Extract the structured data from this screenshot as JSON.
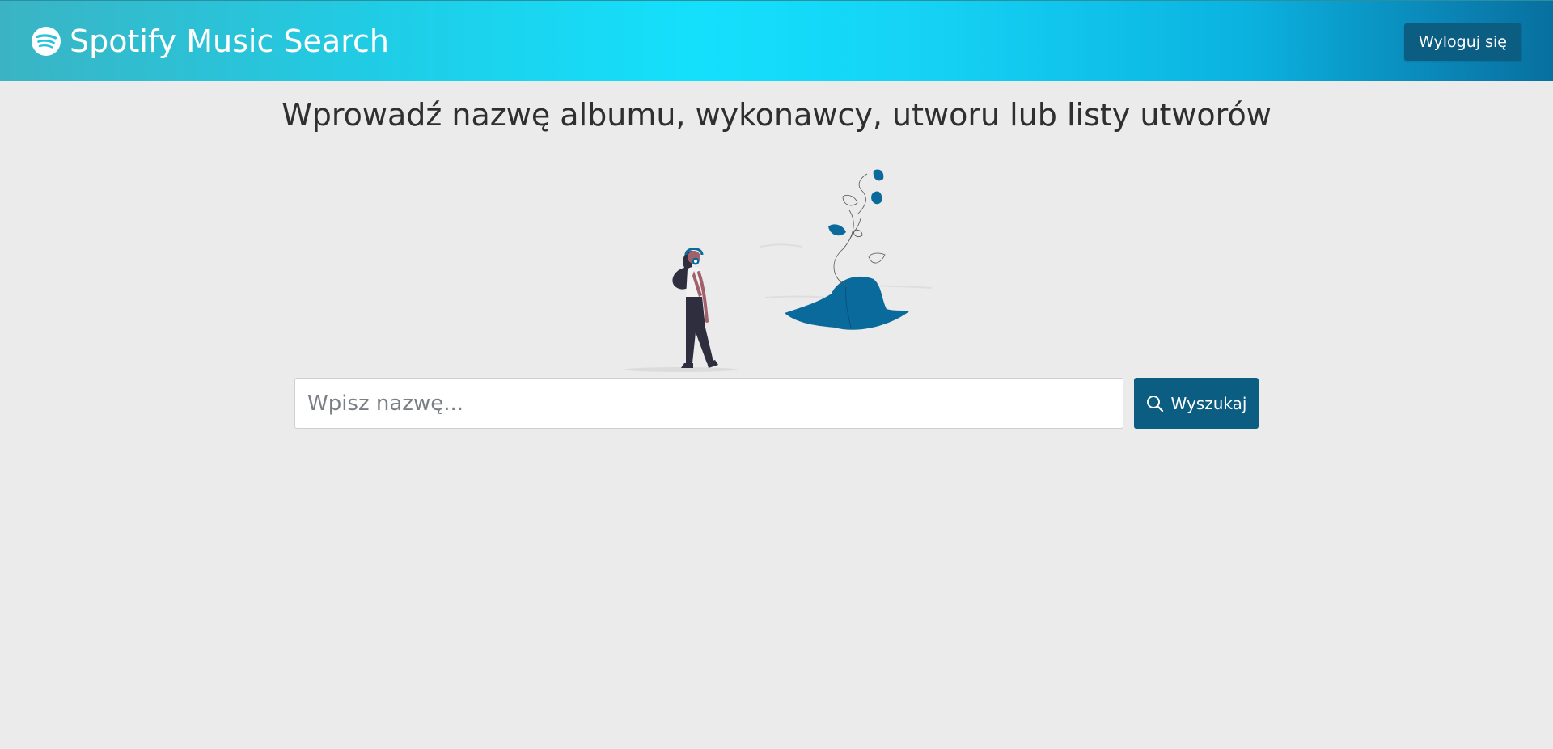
{
  "navbar": {
    "brand_icon": "spotify-logo-icon",
    "brand_title": "Spotify Music Search",
    "logout_label": "Wyloguj się"
  },
  "main": {
    "heading": "Wprowadź nazwę albumu, wykonawcy, utworu lub listy utworów",
    "illustration": "woman-with-headphones-listening-music-illustration",
    "search": {
      "placeholder": "Wpisz nazwę...",
      "value": "",
      "button_label": "Wyszukaj",
      "button_icon": "search-icon"
    }
  },
  "colors": {
    "accent": "#0c5d82",
    "illustration_blue": "#0b6a9c",
    "background": "#ebebeb"
  }
}
